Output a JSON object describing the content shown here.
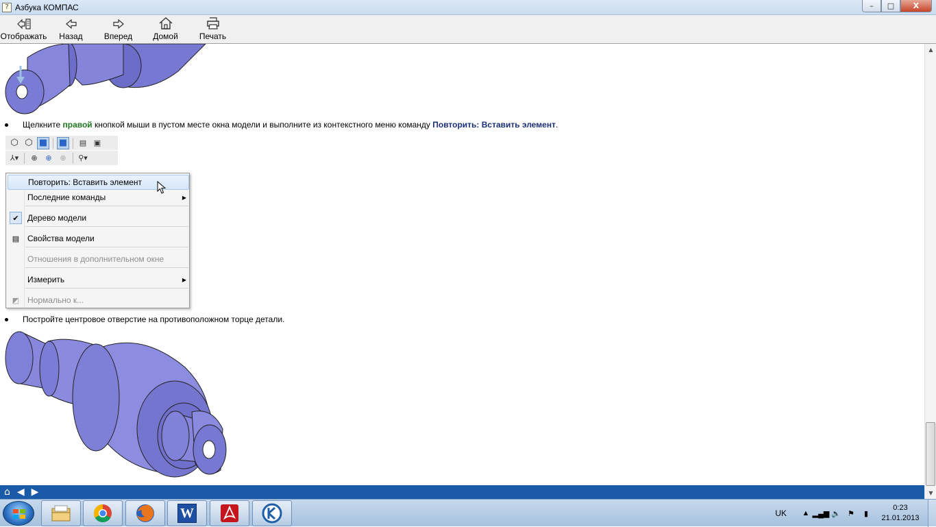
{
  "window": {
    "title": "Азбука КОМПАС",
    "minimize": "–",
    "maximize": "□",
    "close": "X"
  },
  "toolbar": {
    "show": "Отображать",
    "back": "Назад",
    "forward": "Вперед",
    "home": "Домой",
    "print": "Печать"
  },
  "content": {
    "step1": {
      "pre": "Щелкните ",
      "bold_green": "правой",
      "mid": " кнопкой мыши в пустом месте окна модели и выполните из контекстного меню команду ",
      "bold_navy": "Повторить: Вставить элемент",
      "post": "."
    },
    "step2": "Постройте центровое отверстие на противоположном торце детали."
  },
  "context_menu": {
    "items": [
      {
        "label": "Повторить: Вставить элемент",
        "highlighted": true
      },
      {
        "label": "Последние команды",
        "submenu": true
      },
      {
        "label": "Дерево модели",
        "checked": true
      },
      {
        "label": "Свойства модели",
        "icon": "properties-icon"
      },
      {
        "label": "Отношения в дополнительном окне",
        "disabled": true
      },
      {
        "label": "Измерить",
        "submenu": true
      },
      {
        "label": "Нормально к...",
        "disabled": true,
        "icon": "normal-view-icon"
      }
    ]
  },
  "navbar": {
    "home": "⌂",
    "prev": "◀",
    "next": "▶"
  },
  "taskbar": {
    "apps": [
      "file-explorer-icon",
      "chrome-icon",
      "firefox-icon",
      "word-icon",
      "acrobat-icon",
      "kompas-icon"
    ],
    "word_letter": "W",
    "language": "UK",
    "time": "0:23",
    "date": "21.01.2013"
  },
  "colors": {
    "nav_blue": "#1b5aa8",
    "model_part": "#7f80d8",
    "highlight_green": "#217821",
    "highlight_navy": "#1b2f7a"
  }
}
